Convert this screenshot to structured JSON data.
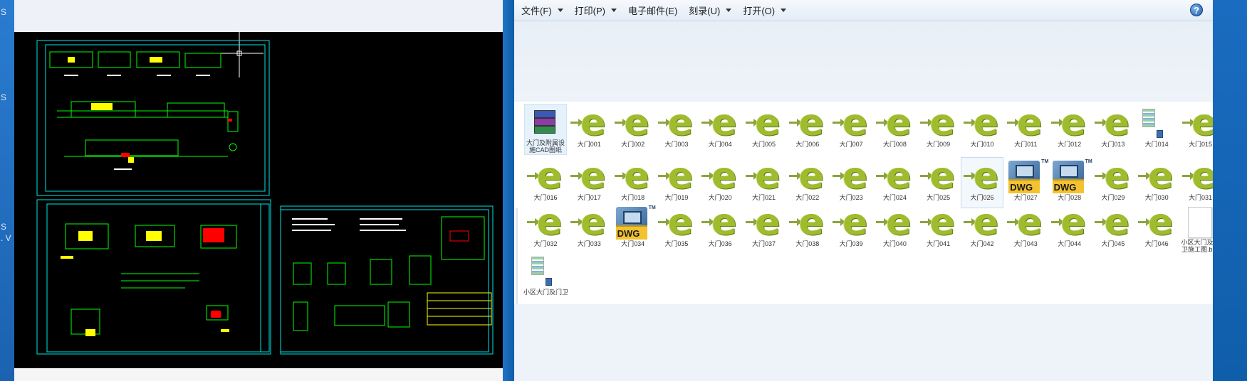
{
  "left_edge": {
    "texts": [
      "S",
      "S",
      "S",
      ". V"
    ]
  },
  "cad_preview": {
    "background": "#000000",
    "line_colors": [
      "#00ffff",
      "#00ff00",
      "#ffff00",
      "#ff0000",
      "#ffffff"
    ]
  },
  "menu": [
    {
      "label": "文件(F)",
      "has_dropdown": true
    },
    {
      "label": "打印(P)",
      "has_dropdown": true
    },
    {
      "label": "电子邮件(E)",
      "has_dropdown": false
    },
    {
      "label": "刻录(U)",
      "has_dropdown": true
    },
    {
      "label": "打开(O)",
      "has_dropdown": true
    }
  ],
  "help_label": "?",
  "files": [
    {
      "name": "大门及附属设施CAD图纸",
      "type": "rar",
      "state": "selected"
    },
    {
      "name": "大门001",
      "type": "e"
    },
    {
      "name": "大门002",
      "type": "e"
    },
    {
      "name": "大门003",
      "type": "e"
    },
    {
      "name": "大门004",
      "type": "e"
    },
    {
      "name": "大门005",
      "type": "e"
    },
    {
      "name": "大门006",
      "type": "e"
    },
    {
      "name": "大门007",
      "type": "e"
    },
    {
      "name": "大门008",
      "type": "e"
    },
    {
      "name": "大门009",
      "type": "e"
    },
    {
      "name": "大门010",
      "type": "e"
    },
    {
      "name": "大门011",
      "type": "e"
    },
    {
      "name": "大门012",
      "type": "e"
    },
    {
      "name": "大门013",
      "type": "e"
    },
    {
      "name": "大门014",
      "type": "thumb"
    },
    {
      "name": "大门015",
      "type": "e"
    },
    {
      "name": "大门016",
      "type": "e"
    },
    {
      "name": "大门017",
      "type": "e"
    },
    {
      "name": "大门018",
      "type": "e"
    },
    {
      "name": "大门019",
      "type": "e"
    },
    {
      "name": "大门020",
      "type": "e"
    },
    {
      "name": "大门021",
      "type": "e"
    },
    {
      "name": "大门022",
      "type": "e"
    },
    {
      "name": "大门023",
      "type": "e"
    },
    {
      "name": "大门024",
      "type": "e"
    },
    {
      "name": "大门025",
      "type": "e"
    },
    {
      "name": "大门026",
      "type": "e",
      "state": "hover"
    },
    {
      "name": "大门027",
      "type": "dwg"
    },
    {
      "name": "大门028",
      "type": "dwg"
    },
    {
      "name": "大门029",
      "type": "e"
    },
    {
      "name": "大门030",
      "type": "e"
    },
    {
      "name": "大门031",
      "type": "e"
    },
    {
      "name": "大门032",
      "type": "e"
    },
    {
      "name": "大门033",
      "type": "e"
    },
    {
      "name": "大门034",
      "type": "dwg"
    },
    {
      "name": "大门035",
      "type": "e"
    },
    {
      "name": "大门036",
      "type": "e"
    },
    {
      "name": "大门037",
      "type": "e"
    },
    {
      "name": "大门038",
      "type": "e"
    },
    {
      "name": "大门039",
      "type": "e"
    },
    {
      "name": "大门040",
      "type": "e"
    },
    {
      "name": "大门041",
      "type": "e"
    },
    {
      "name": "大门042",
      "type": "e"
    },
    {
      "name": "大门043",
      "type": "e"
    },
    {
      "name": "大门044",
      "type": "e"
    },
    {
      "name": "大门045",
      "type": "e"
    },
    {
      "name": "大门046",
      "type": "e"
    },
    {
      "name": "小区大门及门卫施工图.bak",
      "type": "blank"
    },
    {
      "name": "小区大门及门卫",
      "type": "thumb"
    }
  ],
  "dwg_badge": "DWG",
  "tm_mark": "TM",
  "e_glyph": "e"
}
